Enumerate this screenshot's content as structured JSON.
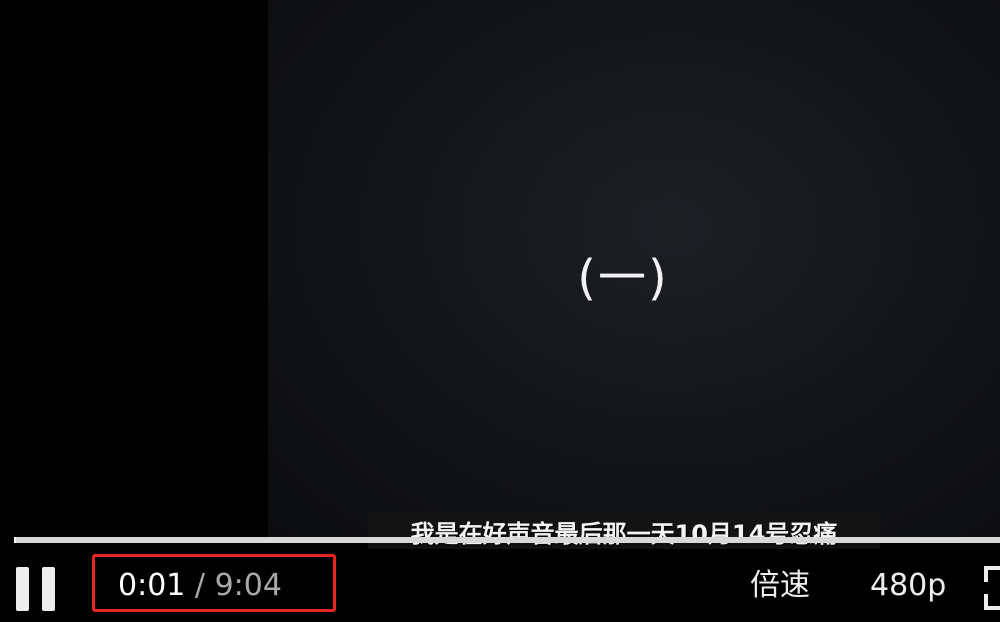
{
  "video": {
    "chapter_text": "(一)",
    "subtitle": "我是在好声音最后那一天10月14号忍痛"
  },
  "progress": {
    "fraction": 0.002
  },
  "controls": {
    "pause_icon": "pause-icon",
    "current_time": "0:01",
    "separator": " / ",
    "total_time": "9:04",
    "speed_label": "倍速",
    "quality_label": "480p",
    "fullscreen_icon": "fullscreen-icon",
    "highlight_color": "#e8261e"
  }
}
